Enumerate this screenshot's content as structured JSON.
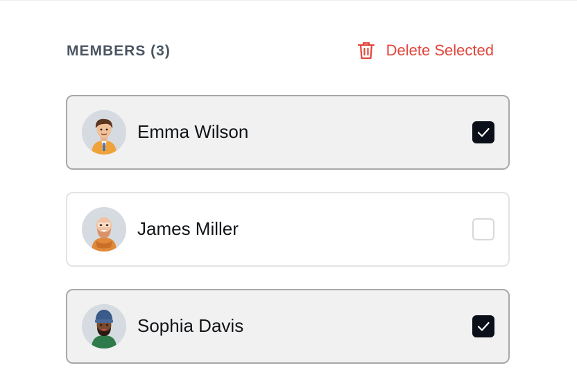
{
  "header": {
    "title": "MEMBERS (3)",
    "delete_label": "Delete Selected",
    "delete_icon": "trash-icon",
    "accent_color": "#e0453a"
  },
  "members": [
    {
      "name": "Emma Wilson",
      "selected": true,
      "avatar": "avatar-man-brown-hair-orange-jacket"
    },
    {
      "name": "James Miller",
      "selected": false,
      "avatar": "avatar-bald-man-beard-orange-scarf"
    },
    {
      "name": "Sophia Davis",
      "selected": true,
      "avatar": "avatar-man-beanie-beard-green-shirt"
    }
  ],
  "colors": {
    "checkbox_checked": "#0b0f19",
    "selected_card_bg": "#f1f1f1",
    "selected_card_border": "#a8a8a8"
  }
}
